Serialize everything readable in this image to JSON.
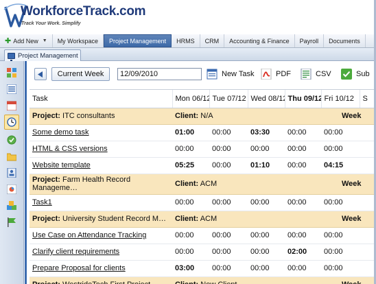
{
  "app": {
    "logo_text": "WorkforceTrack.com",
    "tagline": "Track Your Work. Simplify",
    "accent": "#3c6cb0"
  },
  "nav": {
    "add_new": "Add New",
    "items": [
      "My Workspace",
      "Project Management",
      "HRMS",
      "CRM",
      "Accounting & Finance",
      "Payroll",
      "Documents"
    ],
    "active": "Project Management"
  },
  "subtab": {
    "label": "Project Management"
  },
  "sidebar": {
    "icons": [
      "dashboard-icon",
      "list-icon",
      "calendar-icon",
      "clock-icon",
      "check-icon",
      "folder-icon",
      "address-book-icon",
      "reports-icon",
      "cubes-icon",
      "flag-icon"
    ],
    "active": "clock-icon"
  },
  "toolbar": {
    "current_week": "Current Week",
    "date_value": "12/09/2010",
    "new_task": "New Task",
    "pdf": "PDF",
    "csv": "CSV",
    "submit": "Sub"
  },
  "grid": {
    "headers": [
      "Task",
      "Mon 06/12",
      "Tue 07/12",
      "Wed 08/12",
      "Thu 09/12",
      "Fri 10/12",
      "S"
    ],
    "today_index": 4,
    "rows": [
      {
        "type": "project",
        "name": "ITC consultants",
        "client": "N/A",
        "week_label": "Week"
      },
      {
        "type": "task",
        "name": "Some demo task",
        "hours": [
          "01:00",
          "00:00",
          "03:30",
          "00:00",
          "00:00"
        ],
        "bold": [
          true,
          false,
          true,
          false,
          false
        ]
      },
      {
        "type": "task",
        "name": "HTML & CSS versions",
        "hours": [
          "00:00",
          "00:00",
          "00:00",
          "00:00",
          "00:00"
        ],
        "bold": [
          false,
          false,
          false,
          false,
          false
        ]
      },
      {
        "type": "task",
        "name": "Website template",
        "hours": [
          "05:25",
          "00:00",
          "01:10",
          "00:00",
          "04:15"
        ],
        "bold": [
          true,
          false,
          true,
          false,
          true
        ]
      },
      {
        "type": "project",
        "name": "Farm Health Record Manageme…",
        "client": "ACM",
        "week_label": "Week",
        "tall": true
      },
      {
        "type": "task",
        "name": "Task1",
        "hours": [
          "00:00",
          "00:00",
          "00:00",
          "00:00",
          "00:00"
        ],
        "bold": [
          false,
          false,
          false,
          false,
          false
        ]
      },
      {
        "type": "project",
        "name": "University Student Record M…",
        "client": "ACM",
        "week_label": "Week"
      },
      {
        "type": "task",
        "name": "Use Case on Attendance Tracking",
        "hours": [
          "00:00",
          "00:00",
          "00:00",
          "00:00",
          "00:00"
        ],
        "bold": [
          false,
          false,
          false,
          false,
          false
        ]
      },
      {
        "type": "task",
        "name": "Clarify client requirements",
        "hours": [
          "00:00",
          "00:00",
          "00:00",
          "02:00",
          "00:00"
        ],
        "bold": [
          false,
          false,
          false,
          true,
          false
        ]
      },
      {
        "type": "task",
        "name": "Prepare Proposal for clients",
        "hours": [
          "03:00",
          "00:00",
          "00:00",
          "00:00",
          "00:00"
        ],
        "bold": [
          true,
          false,
          false,
          false,
          false
        ]
      },
      {
        "type": "project",
        "name": "WestrideTech First Project",
        "client": "New Client",
        "week_label": "Week"
      }
    ],
    "labels": {
      "project": "Project:",
      "client": "Client:"
    }
  }
}
